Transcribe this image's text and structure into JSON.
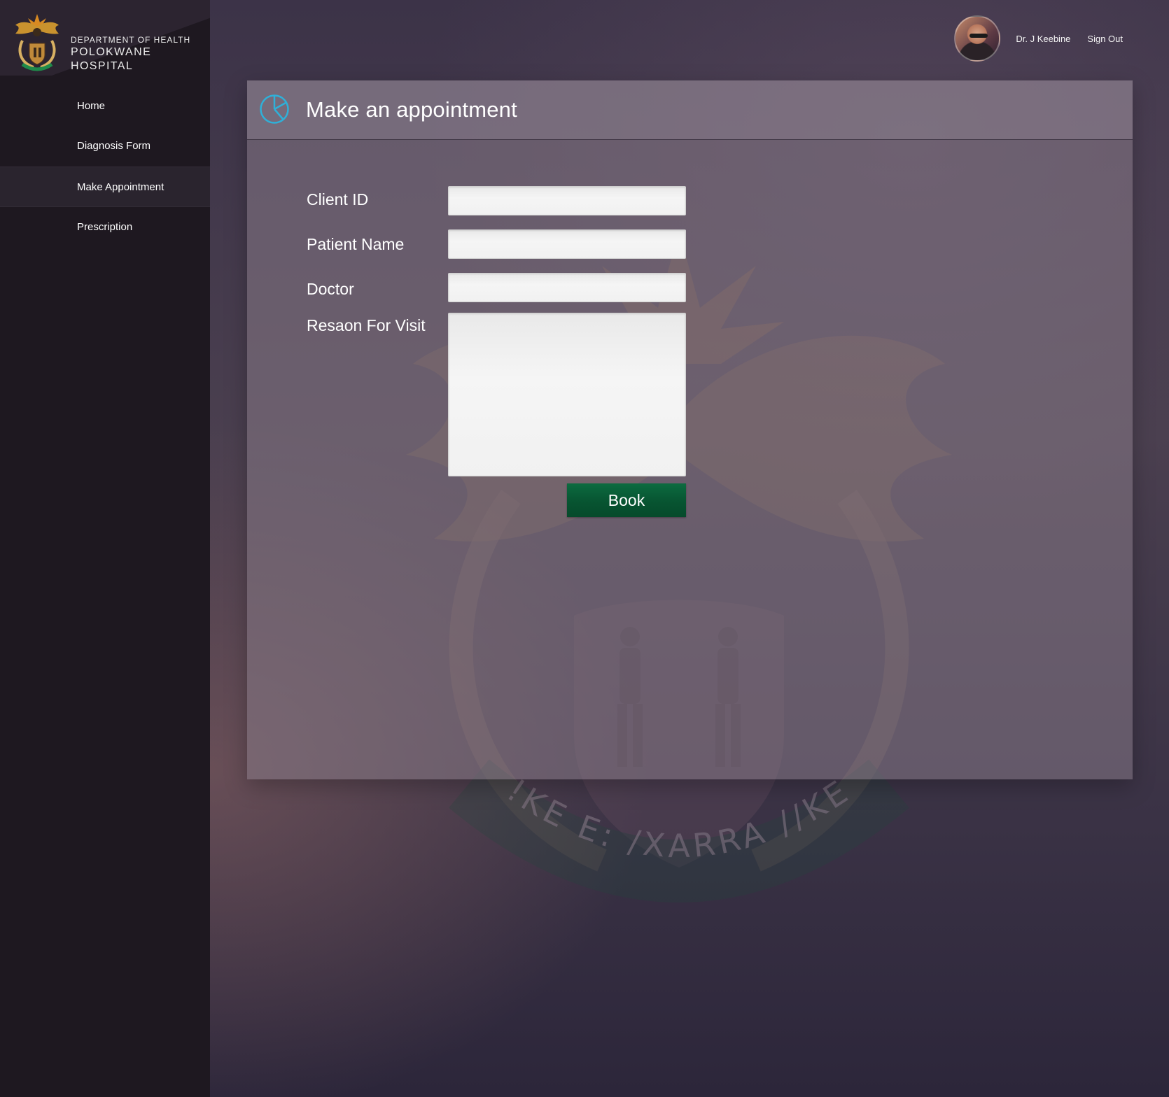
{
  "brand": {
    "department": "Department of Health",
    "hospital": "Polokwane Hospital"
  },
  "nav": {
    "items": [
      {
        "label": "Home"
      },
      {
        "label": "Diagnosis Form"
      },
      {
        "label": "Make Appointment"
      },
      {
        "label": "Prescription"
      }
    ],
    "active": "Make Appointment"
  },
  "user": {
    "name": "Dr. J Keebine",
    "signout_label": "Sign Out"
  },
  "panel": {
    "title": "Make an appointment",
    "icon": "clock-icon",
    "accent_color": "#2fb0d8"
  },
  "form": {
    "client_id": {
      "label": "Client ID",
      "value": ""
    },
    "patient_name": {
      "label": "Patient Name",
      "value": ""
    },
    "doctor": {
      "label": "Doctor",
      "value": ""
    },
    "reason": {
      "label": "Resaon For Visit",
      "value": ""
    },
    "submit_label": "Book",
    "submit_color": "#075431"
  },
  "watermark": {
    "motto": "!KE E: /XARRA //KE"
  }
}
